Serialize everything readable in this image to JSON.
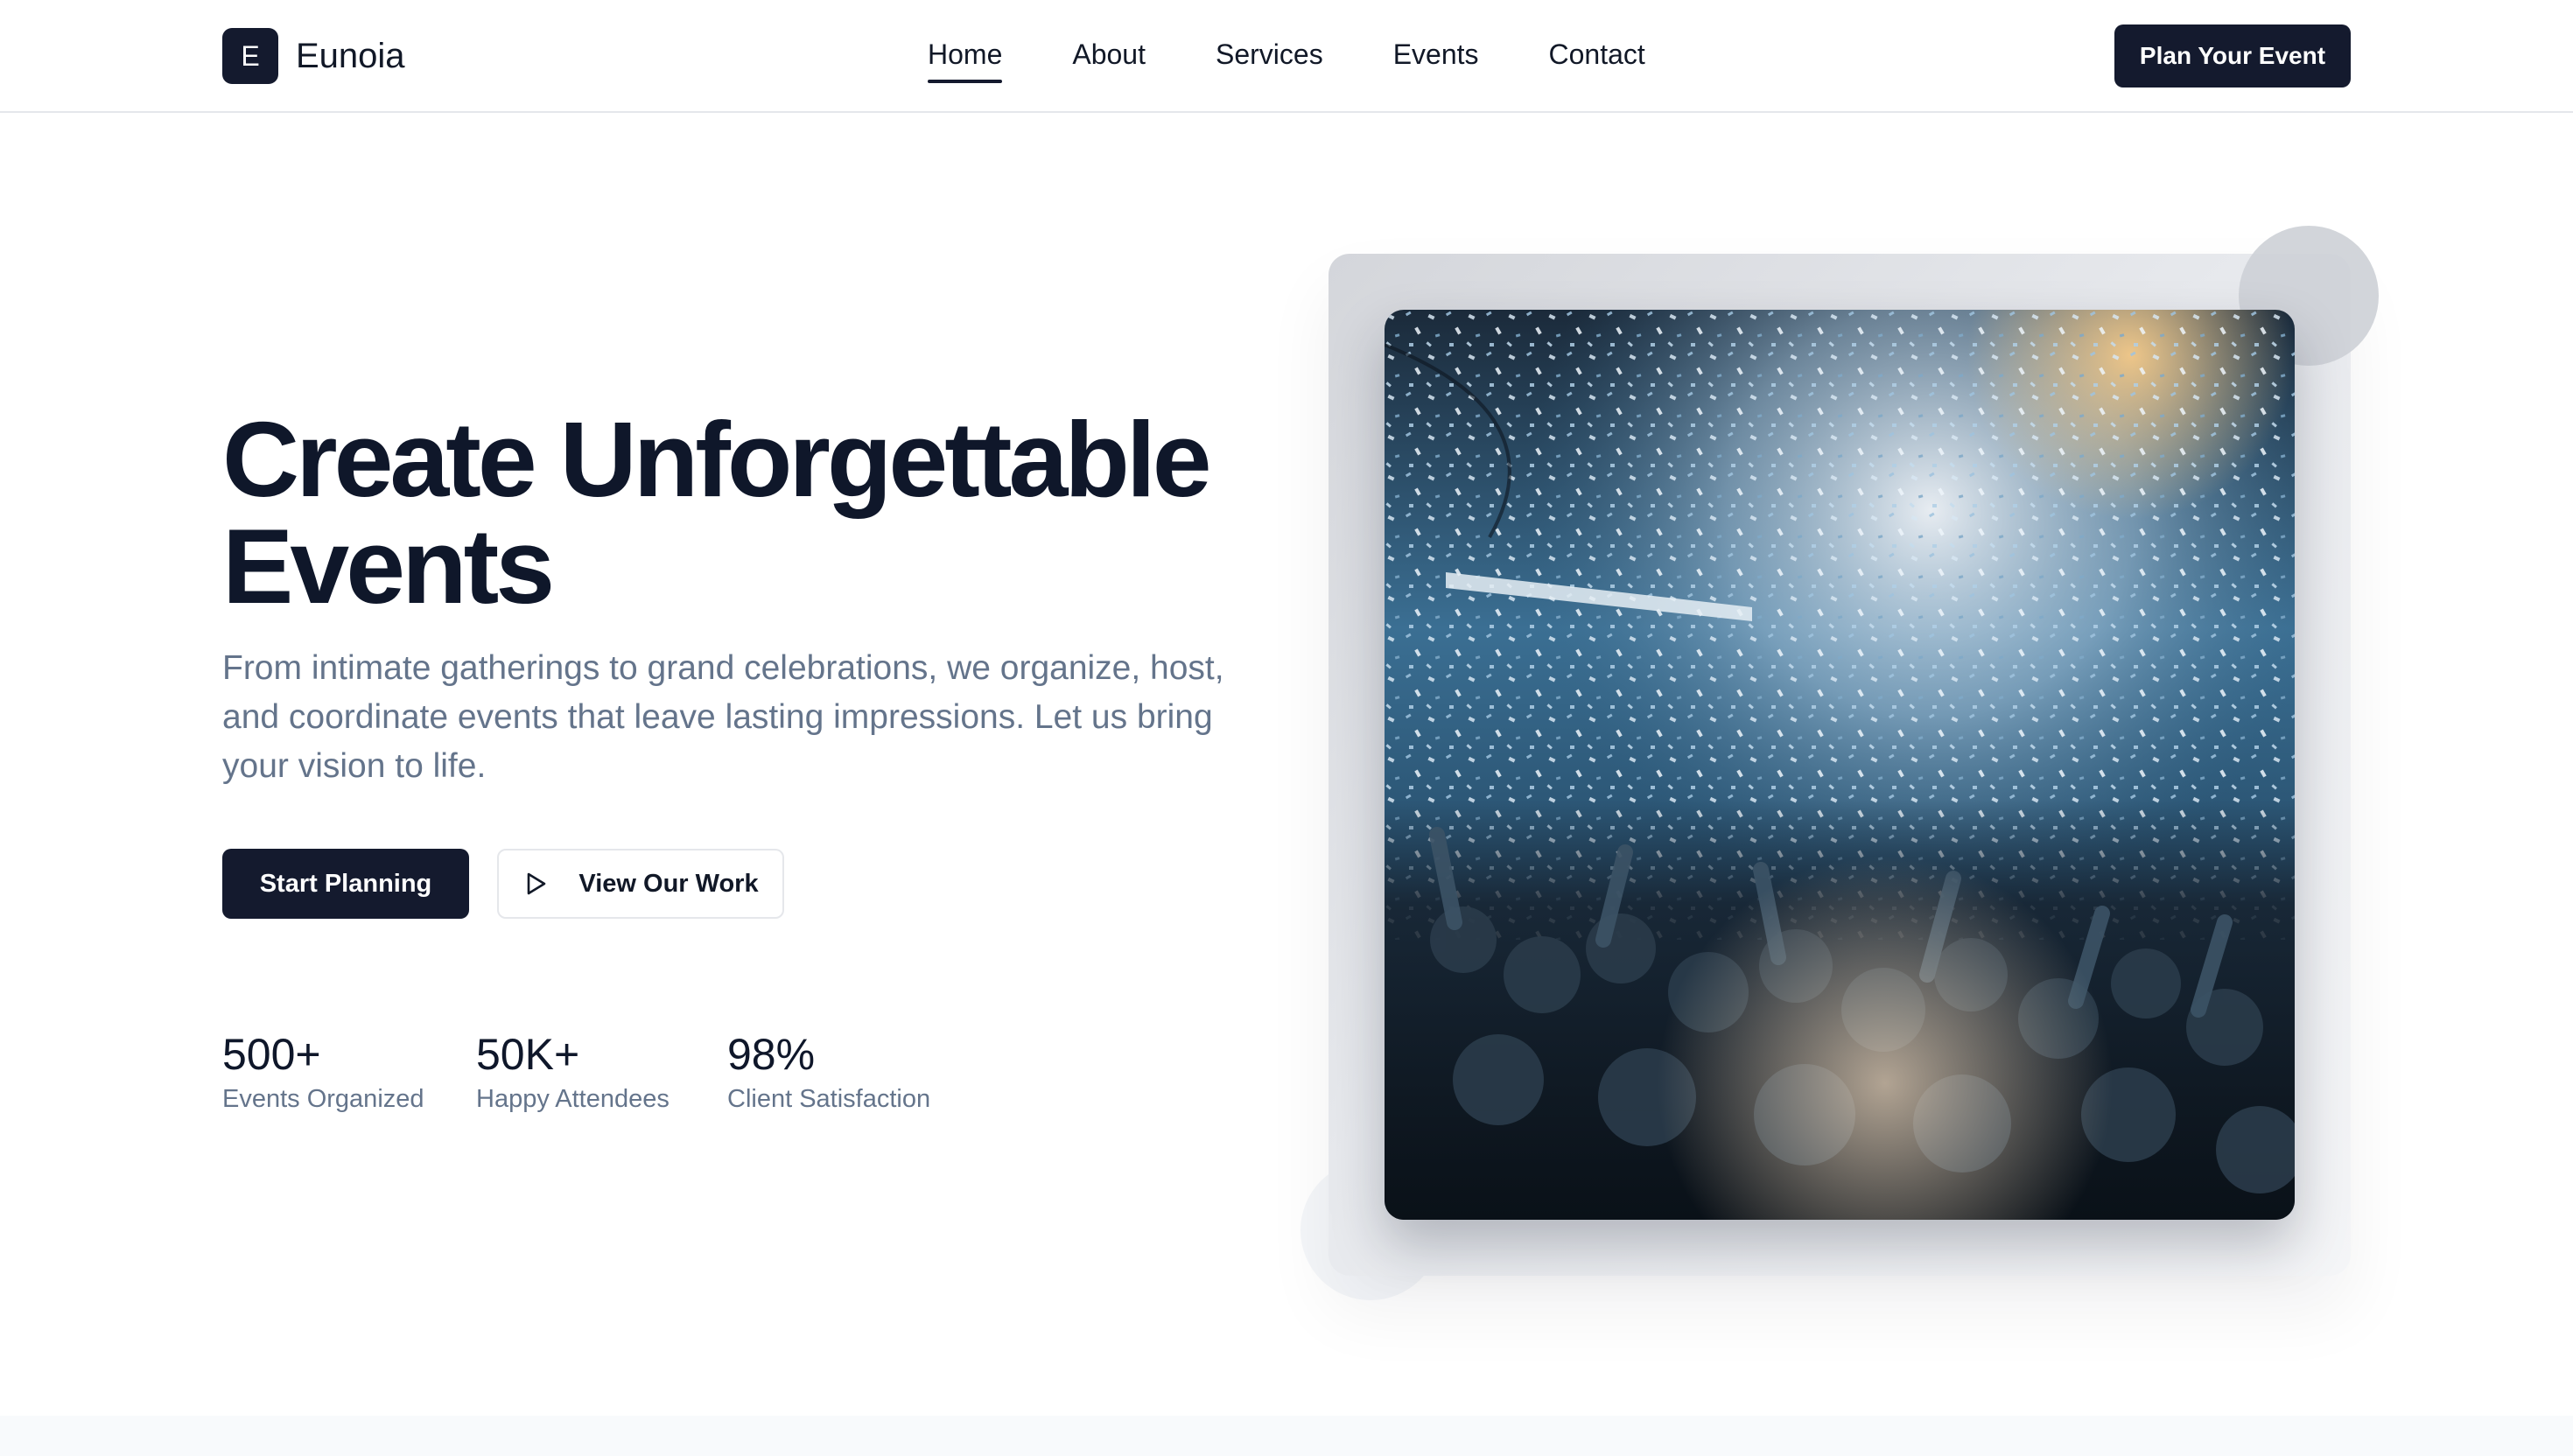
{
  "brand": {
    "logo_letter": "E",
    "name": "Eunoia"
  },
  "nav": {
    "items": [
      {
        "label": "Home",
        "active": true
      },
      {
        "label": "About",
        "active": false
      },
      {
        "label": "Services",
        "active": false
      },
      {
        "label": "Events",
        "active": false
      },
      {
        "label": "Contact",
        "active": false
      }
    ]
  },
  "header": {
    "cta_label": "Plan Your Event"
  },
  "hero": {
    "title_line1": "Create Unforgettable",
    "title_line2": "Events",
    "subtitle": "From intimate gatherings to grand celebrations, we organize, host, and coordinate events that leave lasting impressions. Let us bring your vision to life.",
    "primary_button": "Start Planning",
    "secondary_button": "View Our Work",
    "secondary_icon": "play-icon",
    "stats": [
      {
        "value": "500+",
        "label": "Events Organized"
      },
      {
        "value": "50K+",
        "label": "Happy Attendees"
      },
      {
        "value": "98%",
        "label": "Client Satisfaction"
      }
    ],
    "image_subject": "concert crowd with confetti"
  },
  "colors": {
    "primary": "#141a2e",
    "text": "#0f172a",
    "muted": "#64748b",
    "border": "#e5e7eb"
  }
}
